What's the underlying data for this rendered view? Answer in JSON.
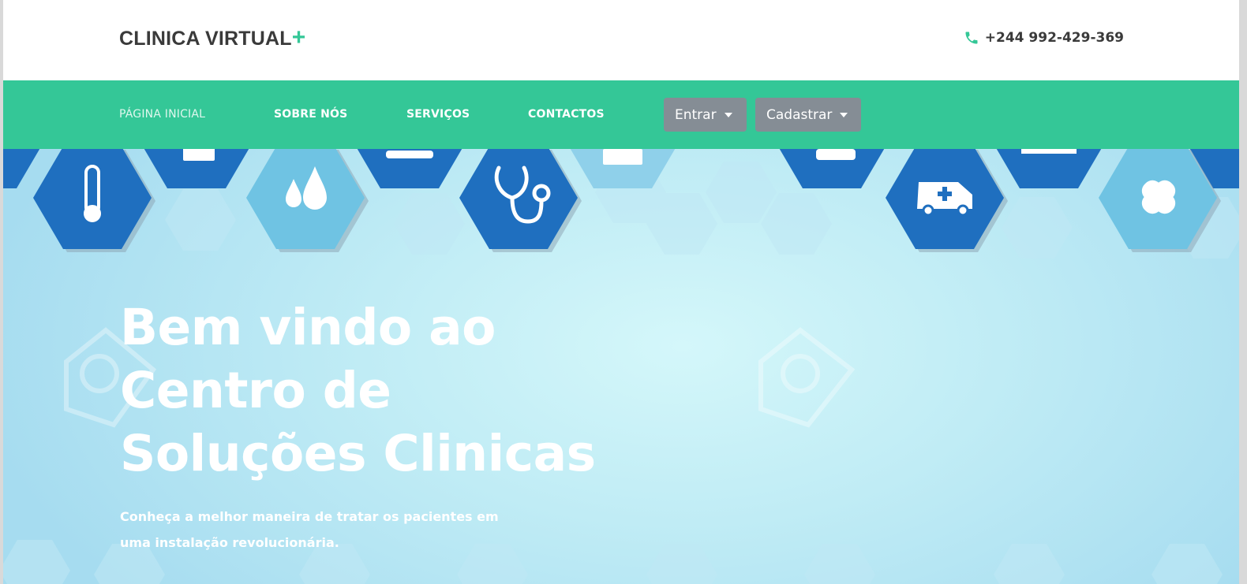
{
  "header": {
    "logo_text": "CLINICA VIRTUAL",
    "logo_plus": "+",
    "phone_icon": "phone-icon",
    "phone": "+244 992-429-369"
  },
  "nav": {
    "items": [
      {
        "label": "PÁGINA INICIAL"
      },
      {
        "label": "SOBRE NÓS"
      },
      {
        "label": "SERVIÇOS"
      },
      {
        "label": "CONTACTOS"
      }
    ],
    "login_dropdown": "Entrar",
    "register_dropdown": "Cadastrar"
  },
  "hero": {
    "title_lines": [
      "Bem vindo ao",
      "Centro de",
      "Soluções Clinicas"
    ],
    "subtitle_lines": [
      "Conheça a melhor maneira de tratar os pacientes em",
      "uma instalação revolucionária."
    ],
    "background_icons": [
      "thermometer-icon",
      "drops-icon",
      "stethoscope-icon",
      "ambulance-icon",
      "bandage-icon"
    ]
  },
  "colors": {
    "accent": "#34c797",
    "dropdown_bg": "#858d95",
    "hex_dark": "#1f6fbf",
    "hex_light": "#6fc3e3"
  }
}
